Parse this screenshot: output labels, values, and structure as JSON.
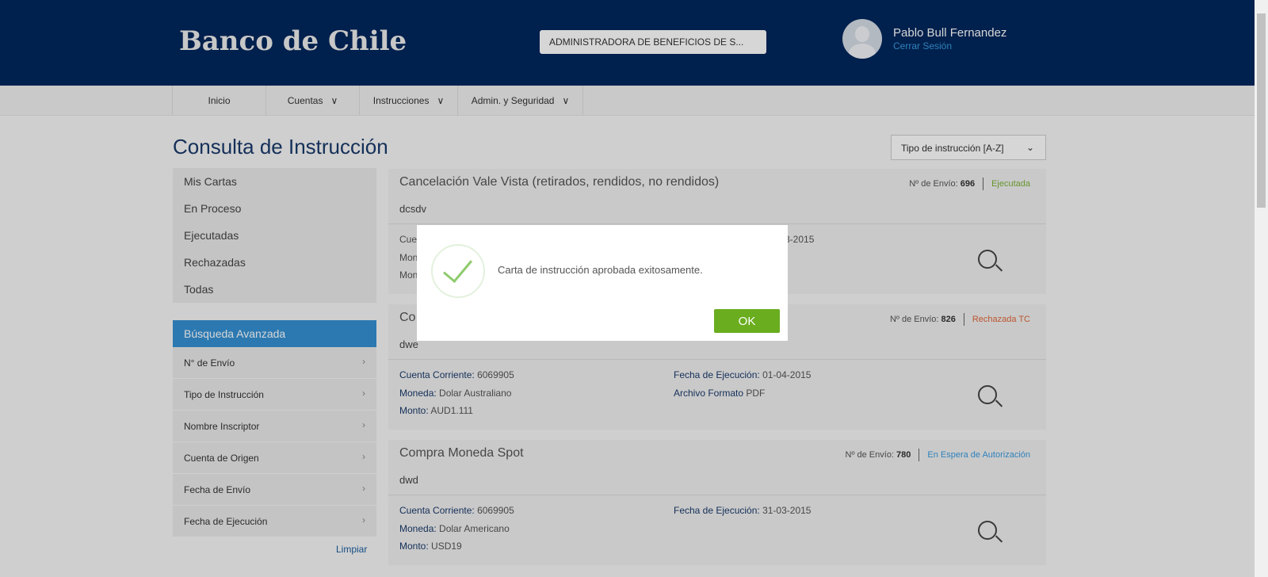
{
  "header": {
    "logo": "Banco de Chile",
    "company": "ADMINISTRADORA DE BENEFICIOS DE S...",
    "user": "Pablo Bull Fernandez",
    "logout": "Cerrar Sesión"
  },
  "nav": [
    "Inicio",
    "Cuentas",
    "Instrucciones",
    "Admin. y Seguridad"
  ],
  "page": {
    "title": "Consulta de Instrucción",
    "sort": "Tipo de instrucción [A-Z]"
  },
  "filters": [
    "Mis Cartas",
    "En Proceso",
    "Ejecutadas",
    "Rechazadas",
    "Todas"
  ],
  "advanced": {
    "title": "Búsqueda Avanzada",
    "rows": [
      "N° de Envío",
      "Tipo de Instrucción",
      "Nombre Inscriptor",
      "Cuenta de Origen",
      "Fecha de Envío",
      "Fecha de Ejecución"
    ],
    "clear": "Limpiar"
  },
  "labels": {
    "envio": "Nº de Envío:",
    "cuenta": "Cuenta Corriente:",
    "moneda": "Moneda:",
    "monto": "Monto:",
    "fecha": "Fecha de Ejecución:",
    "archivo": "Archivo Formato"
  },
  "cards": [
    {
      "title": "Cancelación Vale Vista (retirados, rendidos, no rendidos)",
      "sub": "dcsdv",
      "envio": "696",
      "status": "Ejecutada",
      "status_color": "#7bb23a",
      "cuenta": "Cue",
      "moneda": "Mon",
      "monto": "Mon",
      "fecha": "3-2015"
    },
    {
      "title": "Co",
      "sub": "dwe",
      "envio": "826",
      "status": "Rechazada TC",
      "status_color": "#e0673a",
      "cuenta": "6069905",
      "moneda": "Dolar Australiano",
      "monto": "AUD1.111",
      "fecha": "01-04-2015",
      "archivo": "PDF"
    },
    {
      "title": "Compra Moneda Spot",
      "sub": "dwd",
      "envio": "780",
      "status": "En Espera de Autorización",
      "status_color": "#3a9be0",
      "cuenta": "6069905",
      "moneda": "Dolar Americano",
      "monto": "USD19",
      "fecha": "31-03-2015"
    }
  ],
  "modal": {
    "message": "Carta de instrucción aprobada exitosamente.",
    "ok": "OK"
  }
}
